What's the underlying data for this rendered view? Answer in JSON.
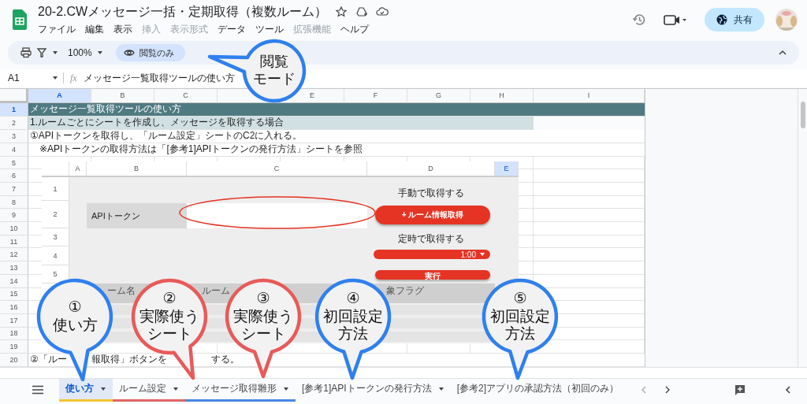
{
  "document": {
    "title": "20-2.CWメッセージ一括・定期取得（複数ルーム）",
    "menu": [
      {
        "label": "ファイル",
        "disabled": false
      },
      {
        "label": "編集",
        "disabled": false
      },
      {
        "label": "表示",
        "disabled": false
      },
      {
        "label": "挿入",
        "disabled": true
      },
      {
        "label": "表示形式",
        "disabled": true
      },
      {
        "label": "データ",
        "disabled": false
      },
      {
        "label": "ツール",
        "disabled": false
      },
      {
        "label": "拡張機能",
        "disabled": true
      },
      {
        "label": "ヘルプ",
        "disabled": false
      }
    ]
  },
  "share_button": "共有",
  "toolbar": {
    "zoom": "100%",
    "mode_chip": "閲覧のみ"
  },
  "formula_bar": {
    "cell": "A1",
    "fx": "fx",
    "content": "メッセージ一覧取得ツールの使い方"
  },
  "sheet": {
    "columns": [
      {
        "label": "A",
        "selected": true
      },
      {
        "label": "B",
        "selected": false
      },
      {
        "label": "C",
        "selected": false
      },
      {
        "selected": false
      },
      {
        "label": "E",
        "selected": false
      },
      {
        "label": "F",
        "selected": false
      },
      {
        "label": "G",
        "selected": false
      },
      {
        "label": "H",
        "selected": false
      },
      {
        "label": "I",
        "selected": false
      }
    ],
    "rows": [
      {
        "number": "1",
        "selected": true,
        "kind": "title",
        "text": "メッセージ一覧取得ツールの使い方"
      },
      {
        "number": "2",
        "selected": false,
        "kind": "section",
        "text": "1.ルームごとにシートを作成し、メッセージを取得する場合"
      },
      {
        "number": "3",
        "selected": false,
        "kind": "text",
        "text": "①APIトークンを取得し、「ルーム設定」シートのC2に入れる。"
      },
      {
        "number": "4",
        "selected": false,
        "kind": "text",
        "text": "　※APIトークンの取得方法は「[参考1]APIトークンの発行方法」シートを参照"
      },
      {
        "number": "5",
        "selected": false,
        "kind": "blank"
      },
      {
        "number": "6",
        "selected": false,
        "kind": "blank"
      },
      {
        "number": "7",
        "selected": false,
        "kind": "blank"
      },
      {
        "number": "8",
        "selected": false,
        "kind": "blank"
      },
      {
        "number": "9",
        "selected": false,
        "kind": "blank"
      },
      {
        "number": "10",
        "selected": false,
        "kind": "blank"
      },
      {
        "number": "11",
        "selected": false,
        "kind": "blank"
      },
      {
        "number": "12",
        "selected": false,
        "kind": "blank"
      },
      {
        "number": "13",
        "selected": false,
        "kind": "blank"
      },
      {
        "number": "14",
        "selected": false,
        "kind": "blank"
      },
      {
        "number": "15",
        "selected": false,
        "kind": "blank"
      },
      {
        "number": "16",
        "selected": false,
        "kind": "blank"
      },
      {
        "number": "17",
        "selected": false,
        "kind": "blank"
      },
      {
        "number": "18",
        "selected": false,
        "kind": "blank"
      },
      {
        "number": "19",
        "selected": false,
        "kind": "blank"
      },
      {
        "number": "20",
        "selected": false,
        "kind": "fragments",
        "fragments": [
          "②「ルー",
          "報取得」ボタンを",
          "する。"
        ]
      }
    ]
  },
  "embedded": {
    "columns": [
      {
        "label": "A",
        "selected": false
      },
      {
        "label": "B",
        "selected": false
      },
      {
        "label": "C",
        "selected": false
      },
      {
        "label": "D",
        "selected": false
      },
      {
        "label": "E",
        "selected": true
      }
    ],
    "row_numbers": [
      "1",
      "2",
      "3",
      "4",
      "5"
    ],
    "api_label": "APIトークン",
    "manual_label": "手動で取得する",
    "fetch_button": "+ ルーム情報取得",
    "schedule_label": "定時で取得する",
    "time_select": "1:00",
    "run_button": "実行",
    "table_header": [
      "ーム名",
      "ルーム",
      "象フラグ"
    ]
  },
  "sheet_tabs": [
    {
      "label": "使い方",
      "selected": true,
      "color": "#f4c430"
    },
    {
      "label": "ルーム設定",
      "selected": false,
      "color": "#e06666"
    },
    {
      "label": "メッセージ取得雛形",
      "selected": false,
      "color": "#4a86e8"
    },
    {
      "label": "[参考1]APIトークンの発行方法",
      "selected": false
    },
    {
      "label": "[参考2]アプリの承認方法（初回のみ）",
      "selected": false
    }
  ],
  "callouts": [
    {
      "lines": [
        "閲覧",
        "モード"
      ],
      "color": "#2f80ed"
    },
    {
      "lines": [
        "①",
        "使い方"
      ],
      "color": "#2f80ed"
    },
    {
      "lines": [
        "②",
        "実際使う",
        "シート"
      ],
      "color": "#e85a5a"
    },
    {
      "lines": [
        "③",
        "実際使う",
        "シート"
      ],
      "color": "#e85a5a"
    },
    {
      "lines": [
        "④",
        "初回設定",
        "方法"
      ],
      "color": "#2f80ed"
    },
    {
      "lines": [
        "⑤",
        "初回設定",
        "方法"
      ],
      "color": "#2f80ed"
    }
  ]
}
